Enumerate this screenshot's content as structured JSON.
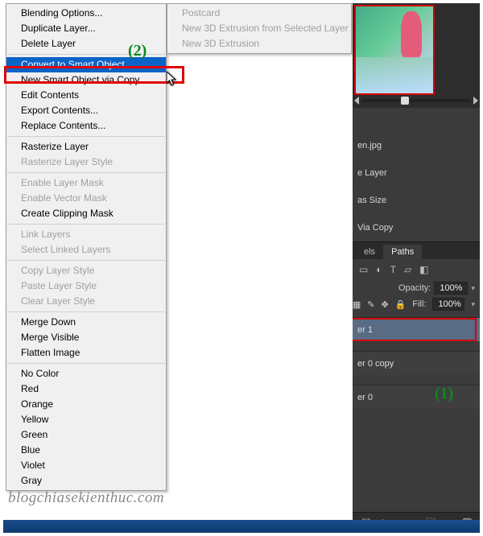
{
  "annotations": {
    "one": "(1)",
    "two": "(2)"
  },
  "watermark": "blogchiasekienthuc.com",
  "menu": {
    "items": [
      {
        "label": "Blending Options...",
        "type": "item"
      },
      {
        "label": "Duplicate Layer...",
        "type": "item"
      },
      {
        "label": "Delete Layer",
        "type": "item"
      },
      {
        "type": "sep"
      },
      {
        "label": "Convert to Smart Object",
        "type": "item",
        "highlight": true
      },
      {
        "label": "New Smart Object via Copy",
        "type": "item"
      },
      {
        "label": "Edit Contents",
        "type": "item"
      },
      {
        "label": "Export Contents...",
        "type": "item"
      },
      {
        "label": "Replace Contents...",
        "type": "item"
      },
      {
        "type": "sep"
      },
      {
        "label": "Rasterize Layer",
        "type": "item"
      },
      {
        "label": "Rasterize Layer Style",
        "type": "item",
        "disabled": true
      },
      {
        "type": "sep"
      },
      {
        "label": "Enable Layer Mask",
        "type": "item",
        "disabled": true
      },
      {
        "label": "Enable Vector Mask",
        "type": "item",
        "disabled": true
      },
      {
        "label": "Create Clipping Mask",
        "type": "item"
      },
      {
        "type": "sep"
      },
      {
        "label": "Link Layers",
        "type": "item",
        "disabled": true
      },
      {
        "label": "Select Linked Layers",
        "type": "item",
        "disabled": true
      },
      {
        "type": "sep"
      },
      {
        "label": "Copy Layer Style",
        "type": "item",
        "disabled": true
      },
      {
        "label": "Paste Layer Style",
        "type": "item",
        "disabled": true
      },
      {
        "label": "Clear Layer Style",
        "type": "item",
        "disabled": true
      },
      {
        "type": "sep"
      },
      {
        "label": "Merge Down",
        "type": "item"
      },
      {
        "label": "Merge Visible",
        "type": "item"
      },
      {
        "label": "Flatten Image",
        "type": "item"
      },
      {
        "type": "sep"
      },
      {
        "label": "No Color",
        "type": "item"
      },
      {
        "label": "Red",
        "type": "item"
      },
      {
        "label": "Orange",
        "type": "item"
      },
      {
        "label": "Yellow",
        "type": "item"
      },
      {
        "label": "Green",
        "type": "item"
      },
      {
        "label": "Blue",
        "type": "item"
      },
      {
        "label": "Violet",
        "type": "item"
      },
      {
        "label": "Gray",
        "type": "item"
      }
    ]
  },
  "submenu": {
    "items": [
      {
        "label": "Postcard",
        "disabled": true
      },
      {
        "label": "New 3D Extrusion from Selected Layer",
        "disabled": true
      },
      {
        "label": "New 3D Extrusion",
        "disabled": true
      }
    ]
  },
  "side_hints": [
    "en.jpg",
    "e Layer",
    "as Size",
    "Via Copy"
  ],
  "panel": {
    "tabs": {
      "channels": "els",
      "paths": "Paths"
    },
    "opacity_label": "Opacity:",
    "opacity_value": "100%",
    "fill_label": "Fill:",
    "fill_value": "100%"
  },
  "layers": [
    {
      "name": "er 1",
      "selected": true,
      "outlined": true
    },
    {
      "name": "er 0 copy",
      "selected": false
    },
    {
      "name": "er 0",
      "selected": false
    }
  ]
}
